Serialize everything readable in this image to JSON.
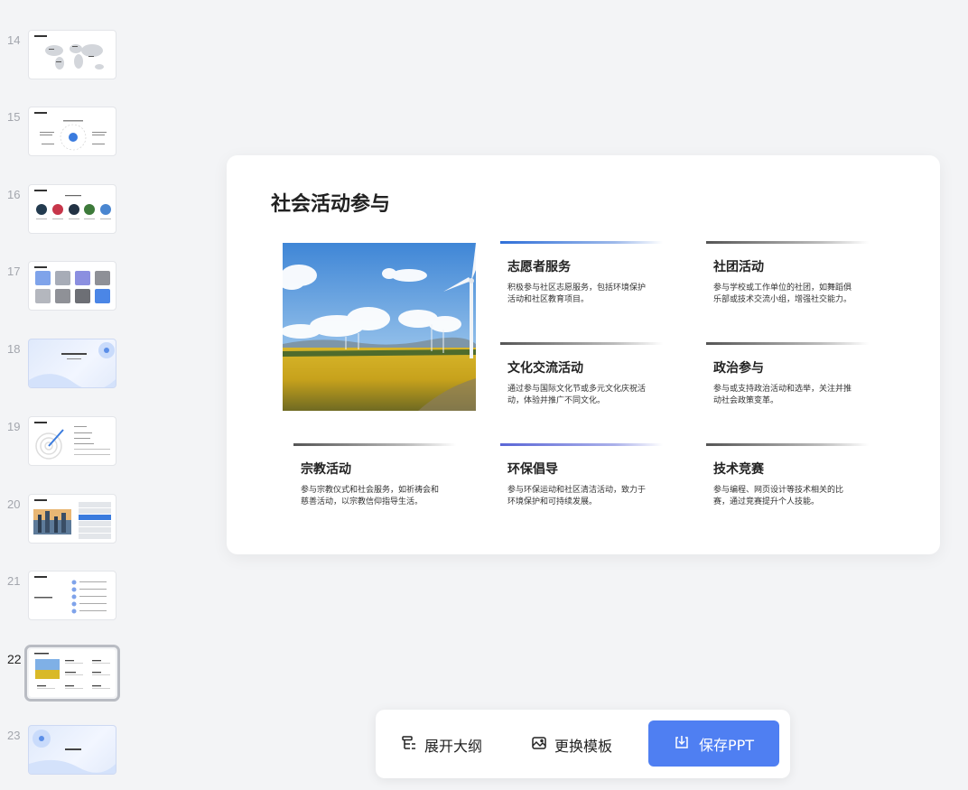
{
  "sidebar": {
    "slides": [
      {
        "num": "14"
      },
      {
        "num": "15"
      },
      {
        "num": "16"
      },
      {
        "num": "17"
      },
      {
        "num": "18"
      },
      {
        "num": "19"
      },
      {
        "num": "20"
      },
      {
        "num": "21"
      },
      {
        "num": "22",
        "active": true
      },
      {
        "num": "23"
      }
    ]
  },
  "slide": {
    "title": "社会活动参与",
    "cards": [
      {
        "title": "志愿者服务",
        "desc": "积极参与社区志愿服务，包括环境保护活动和社区教育项目。"
      },
      {
        "title": "社团活动",
        "desc": "参与学校或工作单位的社团，如舞蹈俱乐部或技术交流小组，增强社交能力。"
      },
      {
        "title": "文化交流活动",
        "desc": "通过参与国际文化节或多元文化庆祝活动，体验并推广不同文化。"
      },
      {
        "title": "政治参与",
        "desc": "参与或支持政治活动和选举，关注并推动社会政策变革。"
      },
      {
        "title": "宗教活动",
        "desc": "参与宗教仪式和社会服务，如祈祷会和慈善活动，以宗教信仰指导生活。"
      },
      {
        "title": "环保倡导",
        "desc": "参与环保运动和社区清洁活动，致力于环境保护和可持续发展。"
      },
      {
        "title": "技术竞赛",
        "desc": "参与编程、网页设计等技术相关的比赛，通过竞赛提升个人技能。"
      }
    ]
  },
  "toolbar": {
    "outline_label": "展开大纲",
    "template_label": "更换模板",
    "save_label": "保存PPT"
  },
  "colors": {
    "accent": "#4f7ff2",
    "background": "#f3f4f6"
  }
}
